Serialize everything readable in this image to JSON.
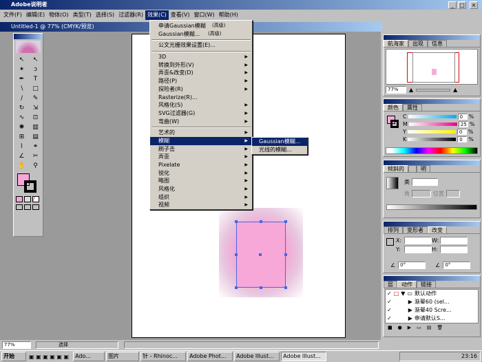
{
  "app": {
    "title": "Adobe说明者"
  },
  "window_buttons": {
    "min": "_",
    "max": "□",
    "close": "×"
  },
  "menubar": [
    "文件(F)",
    "编辑(E)",
    "物体(O)",
    "类型(T)",
    "选择(S)",
    "过滤器(R)",
    "效果(C)",
    "查看(V)",
    "窗口(W)",
    "帮助(H)"
  ],
  "document": {
    "title": "Untitled-1 @ 77% (CMYK/预览)"
  },
  "effects_menu": {
    "group1": [
      "申请Gaussian模糊",
      "Gaussian模糊..."
    ],
    "group1_shortcut": [
      "(高级)",
      "(高级)"
    ],
    "doc_settings": "公文光栅效果设置(E)...",
    "group2": [
      "3D",
      "转换到外形(V)",
      "弄歪&改变(D)",
      "路径(P)",
      "探险者(R)",
      "Rasterize(R)...",
      "风格化(S)",
      "SVG过滤器(G)",
      "弯曲(W)"
    ],
    "group3": [
      "艺术的",
      "模糊",
      "刷子击",
      "弄歪",
      "Pixelate",
      "锐化",
      "略图",
      "风格化",
      "组织",
      "视频"
    ]
  },
  "blur_submenu": [
    "Gaussian模糊...",
    "光线的模糊..."
  ],
  "navigator": {
    "tabs": [
      "航海家",
      "出现",
      "信息"
    ],
    "zoom": "77%"
  },
  "color": {
    "tabs": [
      "颜色",
      "属性"
    ],
    "channels": [
      {
        "label": "C",
        "value": "0"
      },
      {
        "label": "M",
        "value": "25"
      },
      {
        "label": "Y",
        "value": "0"
      },
      {
        "label": "K",
        "value": "0"
      }
    ],
    "unit": "%"
  },
  "gradient": {
    "tabs": [
      "倾斜的",
      "",
      "明"
    ],
    "type_label": "类",
    "type_value": "",
    "angle_label": "角",
    "location_label": "位置"
  },
  "transform": {
    "tabs": [
      "排列",
      "变形者",
      "改变"
    ],
    "fields": [
      "X:",
      "Y:",
      "W:",
      "H:"
    ],
    "angle_value": "0°",
    "shear_value": "0°"
  },
  "actions": {
    "tabs": [
      "层",
      "动作",
      "链接"
    ],
    "items": [
      "默认动作",
      "渐晕60 (sel...",
      "渐晕40 Scre...",
      "申请默认S..."
    ]
  },
  "status": {
    "zoom": "77%",
    "mode": "选择"
  },
  "taskbar": {
    "start": "开始",
    "items": [
      "Ado...",
      "图片",
      "针 - Rhinoc...",
      "Adobe Phot...",
      "Adobe Illust...",
      "Adobe Illust..."
    ],
    "clock": "23:16"
  },
  "colors": {
    "pink": "#f7a8d8",
    "title": "#0a246a",
    "selection": "#4169e1"
  }
}
